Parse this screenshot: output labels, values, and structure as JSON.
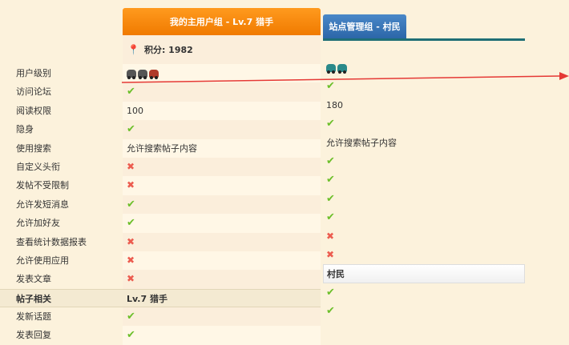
{
  "labels": [
    "用户级别",
    "访问论坛",
    "阅读权限",
    "隐身",
    "使用搜索",
    "自定义头衔",
    "发帖不受限制",
    "允许发短消息",
    "允许加好友",
    "查看统计数据报表",
    "允许使用应用",
    "发表文章",
    "帖子相关",
    "发新话题",
    "发表回复"
  ],
  "col1": {
    "title": "我的主用户组 - Lv.7 猎手",
    "score": "积分: 1982",
    "cells": [
      {
        "type": "cars",
        "cars": [
          "gray",
          "gray",
          "red"
        ]
      },
      {
        "type": "ok"
      },
      {
        "type": "text",
        "text": "100"
      },
      {
        "type": "ok"
      },
      {
        "type": "text",
        "text": "允许搜索帖子内容"
      },
      {
        "type": "no"
      },
      {
        "type": "no"
      },
      {
        "type": "ok"
      },
      {
        "type": "ok"
      },
      {
        "type": "no"
      },
      {
        "type": "no"
      },
      {
        "type": "no"
      },
      {
        "type": "sect",
        "text": "Lv.7 猎手"
      },
      {
        "type": "ok"
      },
      {
        "type": "ok"
      }
    ]
  },
  "col2": {
    "title": "站点管理组 - 村民",
    "cells": [
      {
        "type": "cars",
        "cars": [
          "teal",
          "teal"
        ]
      },
      {
        "type": "ok"
      },
      {
        "type": "text",
        "text": "180"
      },
      {
        "type": "ok"
      },
      {
        "type": "text",
        "text": "允许搜索帖子内容"
      },
      {
        "type": "ok"
      },
      {
        "type": "ok"
      },
      {
        "type": "ok"
      },
      {
        "type": "ok"
      },
      {
        "type": "no"
      },
      {
        "type": "no"
      },
      {
        "type": "sect",
        "text": "村民"
      },
      {
        "type": "ok"
      },
      {
        "type": "ok"
      }
    ]
  },
  "symbols": {
    "ok": "✔",
    "no": "✖"
  },
  "colors": {
    "header_orange": "#f07a00",
    "header_blue": "#2c66a8",
    "check": "#6cbf2a",
    "cross": "#ec5c4f",
    "arrow": "#e53935"
  }
}
